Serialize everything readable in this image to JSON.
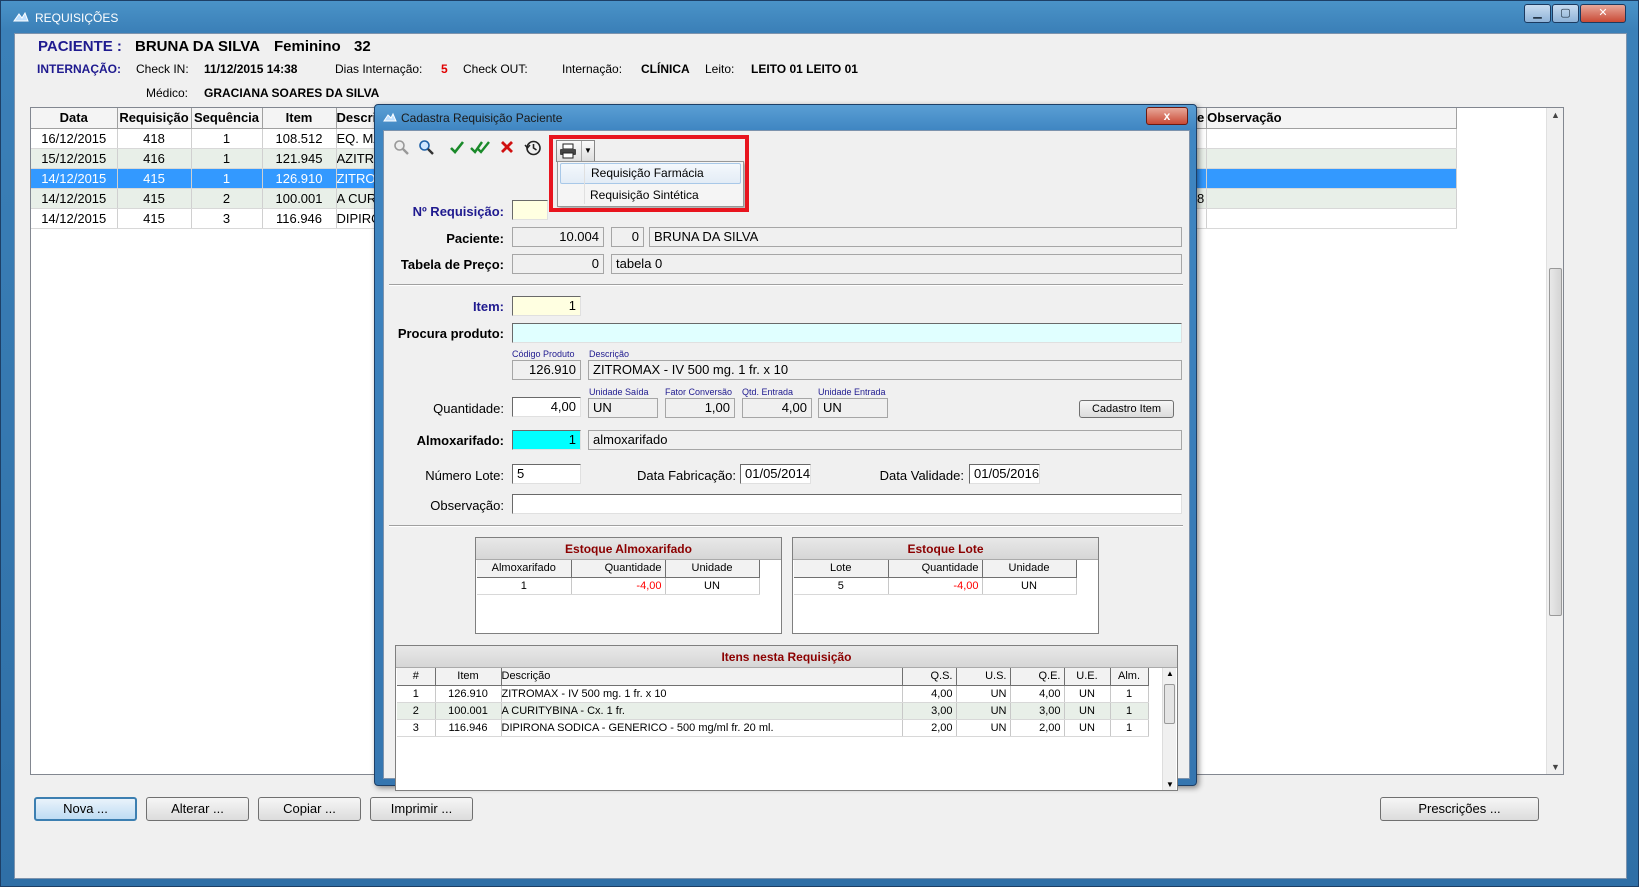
{
  "window": {
    "title": "REQUISIÇÕES"
  },
  "patient": {
    "label": "PACIENTE :",
    "name": "BRUNA DA SILVA",
    "sex": "Feminino",
    "age": "32",
    "internacao_label": "INTERNAÇÃO:",
    "checkin_label": "Check IN:",
    "checkin": "11/12/2015 14:38",
    "dias_label": "Dias Internação:",
    "dias": "5",
    "checkout_label": "Check OUT:",
    "internacao_tipo_label": "Internação:",
    "internacao_tipo": "CLÍNICA",
    "leito_label": "Leito:",
    "leito": "LEITO 01 LEITO 01",
    "medico_label": "Médico:",
    "medico": "GRACIANA SOARES DA SILVA"
  },
  "grid": {
    "columns": [
      "Data",
      "Requisição",
      "Sequência",
      "Item",
      "Descri",
      "Observação"
    ],
    "rows": [
      {
        "data": "16/12/2015",
        "req": "418",
        "seq": "1",
        "item": "108.512",
        "desc": "EQ. MA"
      },
      {
        "data": "15/12/2015",
        "req": "416",
        "seq": "1",
        "item": "121.945",
        "desc": "AZITRO"
      },
      {
        "data": "14/12/2015",
        "req": "415",
        "seq": "1",
        "item": "126.910",
        "desc": "ZITRO"
      },
      {
        "data": "14/12/2015",
        "req": "415",
        "seq": "2",
        "item": "100.001",
        "desc": "A CURI"
      },
      {
        "data": "14/12/2015",
        "req": "415",
        "seq": "3",
        "item": "116.946",
        "desc": "DIPIRO"
      }
    ],
    "extra_header": "e",
    "extra_cell": "8"
  },
  "buttons": {
    "nova": "Nova ...",
    "alterar": "Alterar ...",
    "copiar": "Copiar ...",
    "imprimir": "Imprimir ...",
    "prescricoes": "Prescrições ..."
  },
  "dialog": {
    "title": "Cadastra Requisição Paciente",
    "close": "x",
    "print_menu": [
      "Requisição Farmácia",
      "Requisição Sintética"
    ],
    "labels": {
      "nreq": "Nº Requisição:",
      "paciente": "Paciente:",
      "tabela": "Tabela de Preço:",
      "item": "Item:",
      "procura": "Procura produto:",
      "quantidade": "Quantidade:",
      "almox": "Almoxarifado:",
      "lote": "Número Lote:",
      "fabricacao": "Data Fabricação:",
      "validade": "Data Validade:",
      "obs": "Observação:"
    },
    "captions": {
      "codigo": "Código Produto",
      "descricao": "Descrição",
      "unid_saida": "Unidade Saída",
      "fator": "Fator Conversão",
      "qtd_entrada": "Qtd. Entrada",
      "unid_entrada": "Unidade Entrada"
    },
    "values": {
      "nreq": "",
      "paciente_id": "10.004",
      "paciente_seq": "0",
      "paciente_nome": "BRUNA DA SILVA",
      "tabela_id": "0",
      "tabela_nome": "tabela 0",
      "item": "1",
      "procura": "",
      "codigo": "126.910",
      "descricao": "ZITROMAX - IV 500 mg. 1 fr. x 10",
      "quantidade": "4,00",
      "unid_saida": "UN",
      "fator": "1,00",
      "qtd_entrada": "4,00",
      "unid_entrada": "UN",
      "almox_id": "1",
      "almox_nome": "almoxarifado",
      "lote": "5",
      "fabricacao": "01/05/2014",
      "validade": "01/05/2016",
      "obs": ""
    },
    "cadastro_item": "Cadastro Item",
    "estoque_almox": {
      "title": "Estoque Almoxarifado",
      "columns": [
        "Almoxarifado",
        "Quantidade",
        "Unidade"
      ],
      "row": [
        "1",
        "-4,00",
        "UN"
      ]
    },
    "estoque_lote": {
      "title": "Estoque Lote",
      "columns": [
        "Lote",
        "Quantidade",
        "Unidade"
      ],
      "row": [
        "5",
        "-4,00",
        "UN"
      ]
    },
    "itens": {
      "title": "Itens nesta Requisição",
      "columns": [
        "#",
        "Item",
        "Descrição",
        "Q.S.",
        "U.S.",
        "Q.E.",
        "U.E.",
        "Alm."
      ],
      "rows": [
        [
          "1",
          "126.910",
          "ZITROMAX - IV 500 mg. 1 fr. x 10",
          "4,00",
          "UN",
          "4,00",
          "UN",
          "1"
        ],
        [
          "2",
          "100.001",
          "A CURITYBINA - Cx. 1 fr.",
          "3,00",
          "UN",
          "3,00",
          "UN",
          "1"
        ],
        [
          "3",
          "116.946",
          "DIPIRONA SODICA - GENERICO - 500 mg/ml fr. 20 ml.",
          "2,00",
          "UN",
          "2,00",
          "UN",
          "1"
        ]
      ]
    }
  },
  "colors": {
    "highlight": "#e8141e",
    "selected_row": "#3399ff",
    "label_blue": "#1f1a8f",
    "panel_title": "#8b0000"
  }
}
